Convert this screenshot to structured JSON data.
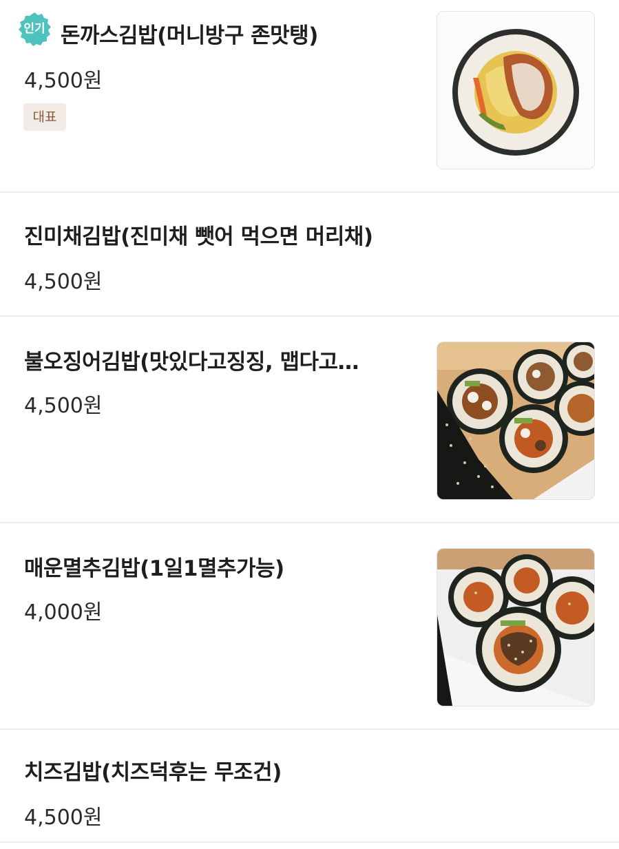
{
  "menu": {
    "items": [
      {
        "name": "돈까스김밥(머니방구 존맛탱)",
        "price": "4,500원",
        "badge": "인기",
        "tag": "대표",
        "image_icon": "cutlet-kimbap-photo"
      },
      {
        "name": "진미채김밥(진미채 뺏어 먹으면 머리채)",
        "price": "4,500원"
      },
      {
        "name": "불오징어김밥(맛있다고징징, 맵다고…",
        "price": "4,500원",
        "image_icon": "squid-kimbap-photo"
      },
      {
        "name": "매운멸추김밥(1일1멸추가능)",
        "price": "4,000원",
        "image_icon": "anchovy-kimbap-photo"
      },
      {
        "name": "치즈김밥(치즈덕후는 무조건)",
        "price": "4,500원"
      }
    ]
  },
  "colors": {
    "badge": "#4fc2bd",
    "tag_bg": "#f3ece6",
    "tag_text": "#8a5a3c",
    "divider": "#ececec"
  }
}
